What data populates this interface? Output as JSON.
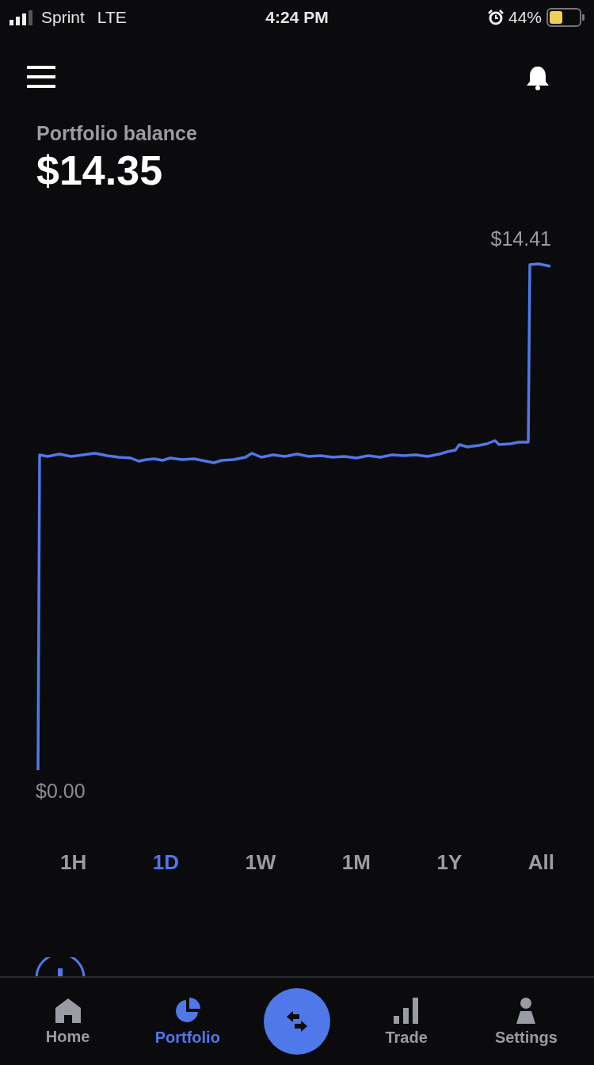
{
  "status_bar": {
    "carrier": "Sprint",
    "network": "LTE",
    "time": "4:24 PM",
    "battery": "44%"
  },
  "balance": {
    "label": "Portfolio balance",
    "value": "$14.35"
  },
  "chart": {
    "high_label": "$14.41",
    "low_label": "$0.00"
  },
  "ranges": [
    {
      "label": "1H",
      "selected": false
    },
    {
      "label": "1D",
      "selected": true
    },
    {
      "label": "1W",
      "selected": false
    },
    {
      "label": "1M",
      "selected": false
    },
    {
      "label": "1Y",
      "selected": false
    },
    {
      "label": "All",
      "selected": false
    }
  ],
  "nav": [
    {
      "kind": "home",
      "label": "Home",
      "selected": false
    },
    {
      "kind": "portfolio",
      "label": "Portfolio",
      "selected": true
    },
    {
      "kind": "trade-action"
    },
    {
      "kind": "trade",
      "label": "Trade",
      "selected": false
    },
    {
      "kind": "settings",
      "label": "Settings",
      "selected": false
    }
  ]
}
